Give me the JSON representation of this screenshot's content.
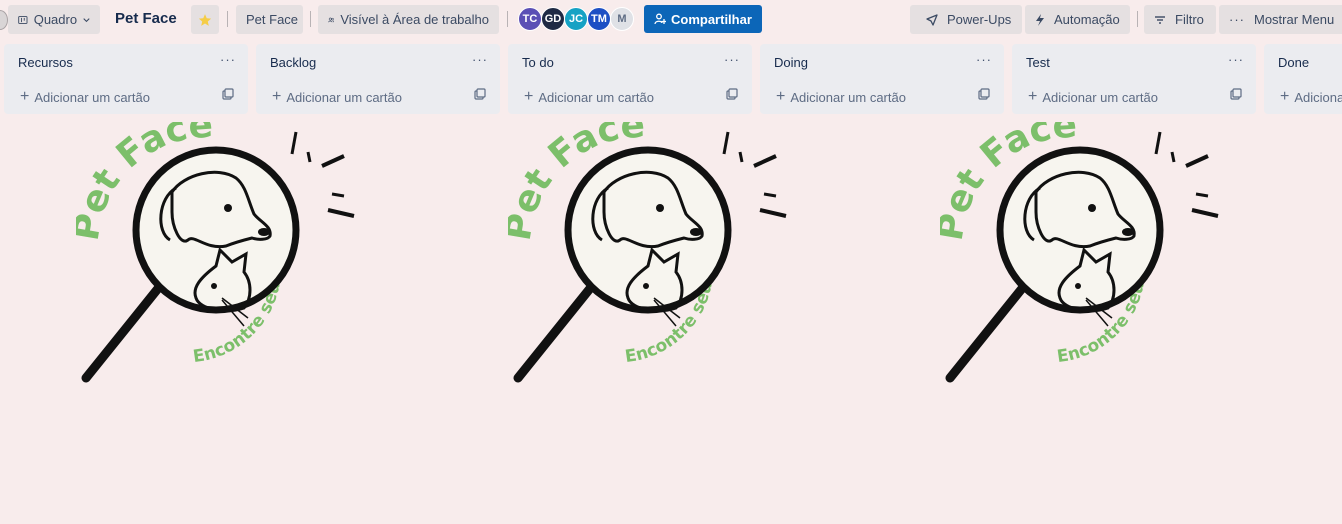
{
  "toolbar": {
    "view_label": "Quadro",
    "board_title": "Pet Face",
    "workspace_label": "Pet Face",
    "visibility_label": "Visível à Área de trabalho",
    "share_label": "Compartilhar",
    "powerups_label": "Power-Ups",
    "automation_label": "Automação",
    "filter_label": "Filtro",
    "menu_label": "Mostrar Menu"
  },
  "members": [
    {
      "initials": "TC",
      "color": "#5b4fb5"
    },
    {
      "initials": "GD",
      "color": "#1f2a44"
    },
    {
      "initials": "JC",
      "color": "#16a2c4"
    },
    {
      "initials": "TM",
      "color": "#1d4fc4"
    },
    {
      "initials": "M",
      "color": "#dfe1e6"
    }
  ],
  "lists": [
    {
      "title": "Recursos",
      "add_label": "Adicionar um cartão"
    },
    {
      "title": "Backlog",
      "add_label": "Adicionar um cartão"
    },
    {
      "title": "To do",
      "add_label": "Adicionar um cartão"
    },
    {
      "title": "Doing",
      "add_label": "Adicionar um cartão"
    },
    {
      "title": "Test",
      "add_label": "Adicionar um cartão"
    },
    {
      "title": "Done",
      "add_label": "Adicionar um cartão"
    }
  ],
  "logo": {
    "brand": "Pet Face",
    "tagline": "Encontre seu Pet"
  },
  "colors": {
    "background": "#f8ecec",
    "share_button": "#0c66b8",
    "star": "#f5cd47",
    "logo_green": "#7cbf6a"
  }
}
